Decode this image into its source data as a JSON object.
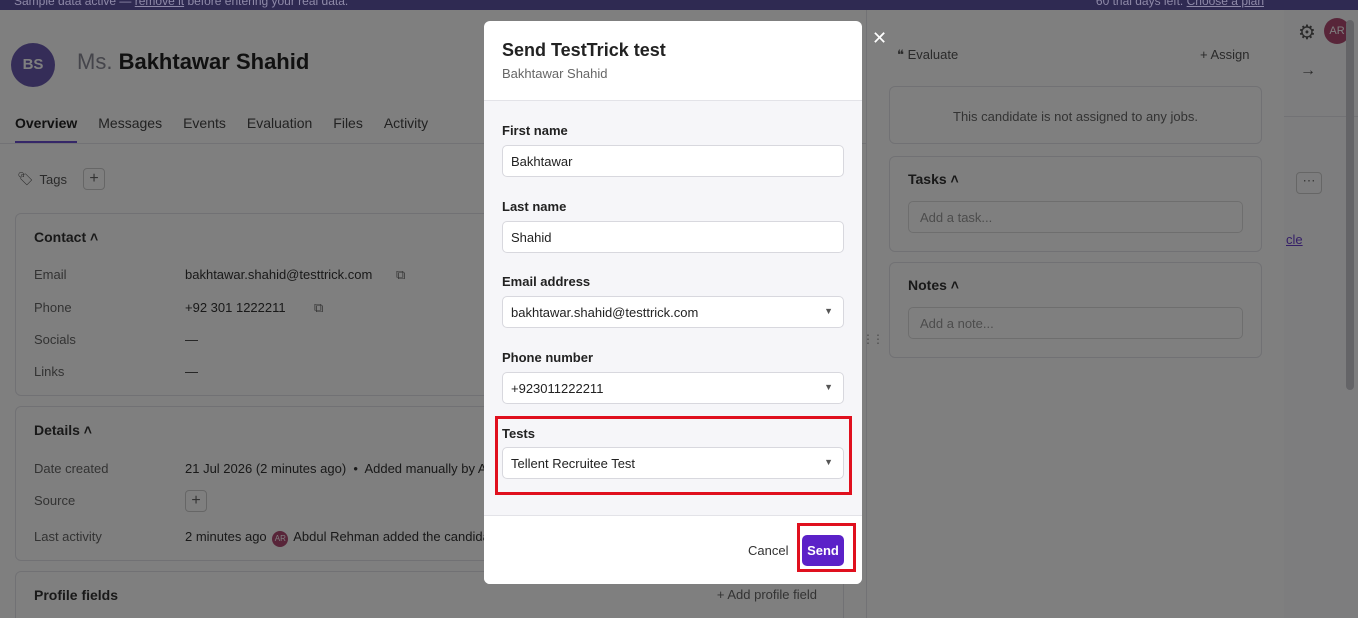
{
  "banner": {
    "left_text": "Sample data active",
    "remove_link": "remove it",
    "left_tail": "before entering your real data.",
    "right_text": "60 trial days left.",
    "choose_plan": "Choose a plan"
  },
  "candidate": {
    "initials": "BS",
    "prefix": "Ms.",
    "name": "Bakhtawar Shahid"
  },
  "tabs": [
    "Overview",
    "Messages",
    "Events",
    "Evaluation",
    "Files",
    "Activity"
  ],
  "tags_label": "Tags",
  "contact": {
    "title": "Contact",
    "rows": [
      {
        "label": "Email",
        "value": "bakhtawar.shahid@testtrick.com"
      },
      {
        "label": "Phone",
        "value": "+92 301 1222211"
      },
      {
        "label": "Socials",
        "value": "—"
      },
      {
        "label": "Links",
        "value": "—"
      }
    ]
  },
  "details": {
    "title": "Details",
    "date_created_label": "Date created",
    "date_created_value": "21 Jul 2026 (2 minutes ago)",
    "added_text": "Added manually by Abdul Rehman",
    "source_label": "Source",
    "last_activity_label": "Last activity",
    "last_activity_time": "2 minutes ago",
    "activity_avatar": "AR",
    "last_activity_text": "Abdul Rehman added the candidate"
  },
  "profile_fields": {
    "title": "Profile fields",
    "add_label": "Add profile field"
  },
  "right_panel": {
    "evaluate_label": "Evaluate",
    "assign_label": "Assign",
    "not_assigned_text": "This candidate is not assigned to any jobs.",
    "tasks_title": "Tasks",
    "tasks_placeholder": "Add a task...",
    "notes_title": "Notes",
    "notes_placeholder": "Add a note...",
    "user_avatar": "AR",
    "link_fragment": "cle"
  },
  "modal": {
    "title": "Send TestTrick test",
    "subtitle": "Bakhtawar Shahid",
    "first_name_label": "First name",
    "first_name_value": "Bakhtawar",
    "last_name_label": "Last name",
    "last_name_value": "Shahid",
    "email_label": "Email address",
    "email_value": "bakhtawar.shahid@testtrick.com",
    "phone_label": "Phone number",
    "phone_value": "+923011222211",
    "tests_label": "Tests",
    "tests_value": "Tellent Recruitee Test",
    "cancel_label": "Cancel",
    "send_label": "Send"
  },
  "colors": {
    "accent": "#5b21c8",
    "highlight": "#e0101e",
    "avatar": "#6b5bb0"
  }
}
